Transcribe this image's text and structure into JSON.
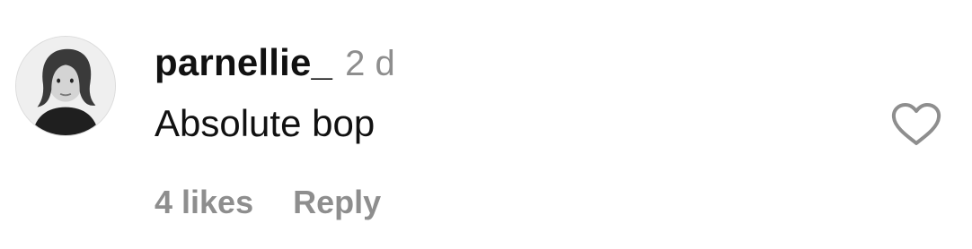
{
  "comment": {
    "avatar_icon": "user-avatar-photo",
    "username": "parnellie_",
    "timestamp": "2 d",
    "text": "Absolute bop",
    "likes_label": "4 likes",
    "reply_label": "Reply",
    "like_icon": "heart-outline-icon"
  },
  "colors": {
    "primary_text": "#111111",
    "secondary_text": "#8e8e8e",
    "background": "#ffffff"
  }
}
